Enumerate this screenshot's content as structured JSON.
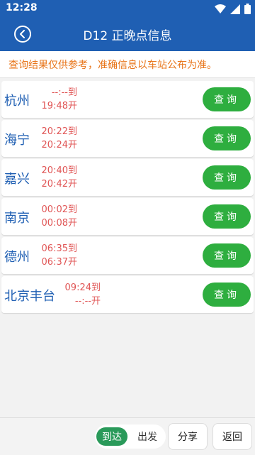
{
  "status_bar": {
    "time": "12:28",
    "icons": [
      "wifi-icon",
      "signal-icon",
      "battery-icon"
    ]
  },
  "app_bar": {
    "title": "D12 正晚点信息",
    "back_icon": "back-circle-icon"
  },
  "notice": "查询结果仅供参考，准确信息以车站公布为准。",
  "stations": [
    {
      "name": "杭州",
      "arrive": "--:--到",
      "depart": "19:48开",
      "query_label": "查询"
    },
    {
      "name": "海宁",
      "arrive": "20:22到",
      "depart": "20:24开",
      "query_label": "查询"
    },
    {
      "name": "嘉兴",
      "arrive": "20:40到",
      "depart": "20:42开",
      "query_label": "查询"
    },
    {
      "name": "南京",
      "arrive": "00:02到",
      "depart": "00:08开",
      "query_label": "查询"
    },
    {
      "name": "德州",
      "arrive": "06:35到",
      "depart": "06:37开",
      "query_label": "查询"
    },
    {
      "name": "北京丰台",
      "arrive": "09:24到",
      "depart": "--:--开",
      "query_label": "查询"
    }
  ],
  "bottom_bar": {
    "toggle_arrive": "到达",
    "toggle_depart": "出发",
    "share": "分享",
    "back": "返回"
  },
  "colors": {
    "primary": "#1f5fb3",
    "accent_orange": "#e8751a",
    "query_green": "#2eae3f",
    "time_red": "#e05555"
  }
}
